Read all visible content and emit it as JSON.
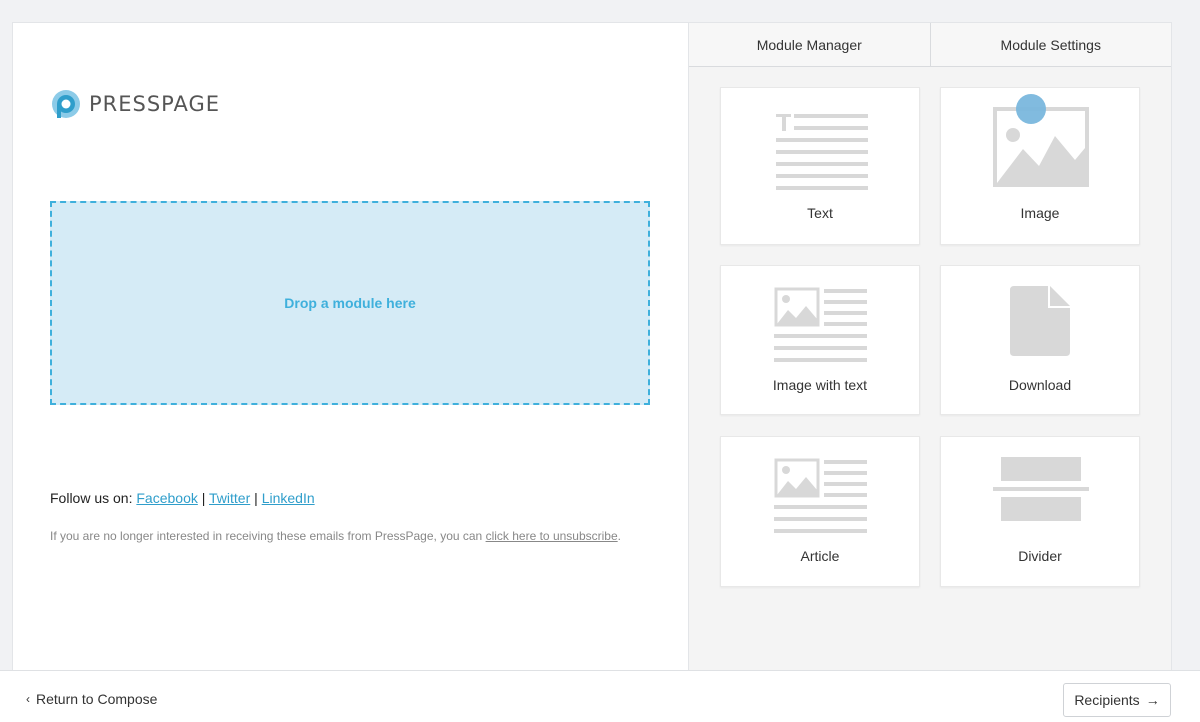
{
  "logo": {
    "text": "PRESSPAGE"
  },
  "dropzone": {
    "label": "Drop a module here"
  },
  "footer_text": {
    "follow_prefix": "Follow us on:",
    "separator": "|",
    "links": [
      "Facebook",
      "Twitter",
      "LinkedIn"
    ],
    "unsubscribe_prefix": "If you are no longer interested in receiving these emails from PressPage, you can",
    "unsubscribe_link": "click here to unsubscribe",
    "unsubscribe_suffix": "."
  },
  "panel": {
    "tabs": [
      "Module Manager",
      "Module Settings"
    ],
    "modules": [
      {
        "label": "Text",
        "icon": "text-icon"
      },
      {
        "label": "Image",
        "icon": "image-icon"
      },
      {
        "label": "Image with text",
        "icon": "image-with-text-icon"
      },
      {
        "label": "Download",
        "icon": "file-icon"
      },
      {
        "label": "Article",
        "icon": "article-icon"
      },
      {
        "label": "Divider",
        "icon": "divider-icon"
      }
    ]
  },
  "footer": {
    "back_label": "Return to Compose",
    "recipients_label": "Recipients"
  },
  "colors": {
    "accent": "#3fb0dc",
    "dropzone_bg": "#d5ebf6",
    "icon_gray": "#d8d8d8"
  }
}
